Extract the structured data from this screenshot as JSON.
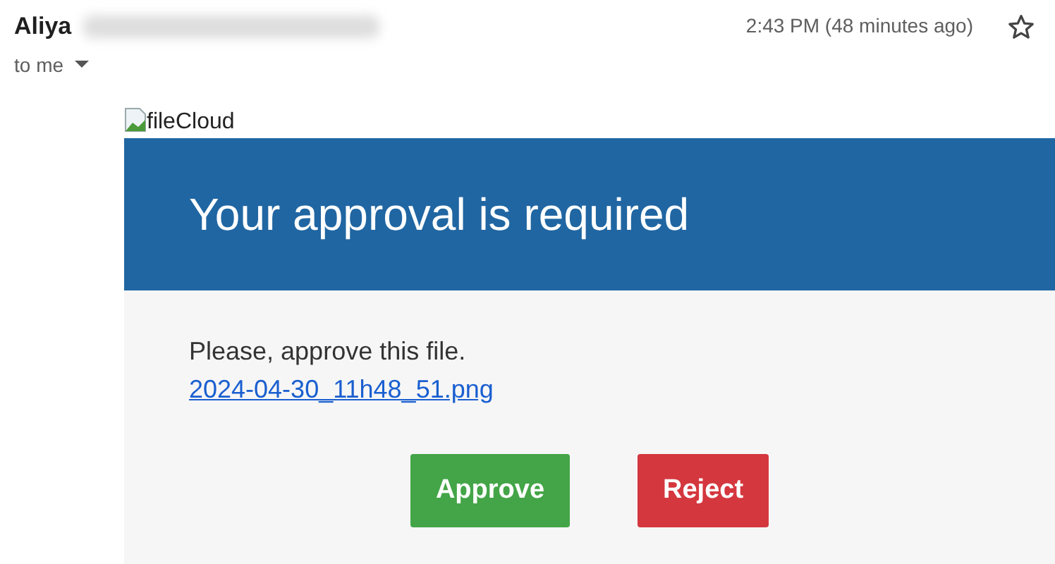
{
  "message": {
    "sender": "Aliya",
    "time": "2:43 PM (48 minutes ago)",
    "starred": false,
    "recipient": "to me"
  },
  "email_body": {
    "logo_alt": "fileCloud",
    "banner_title": "Your approval is required",
    "text": "Please, approve this file.",
    "file_link": "2024-04-30_11h48_51.png",
    "buttons": [
      {
        "label": "Approve",
        "kind": "approve"
      },
      {
        "label": "Reject",
        "kind": "reject"
      }
    ]
  }
}
